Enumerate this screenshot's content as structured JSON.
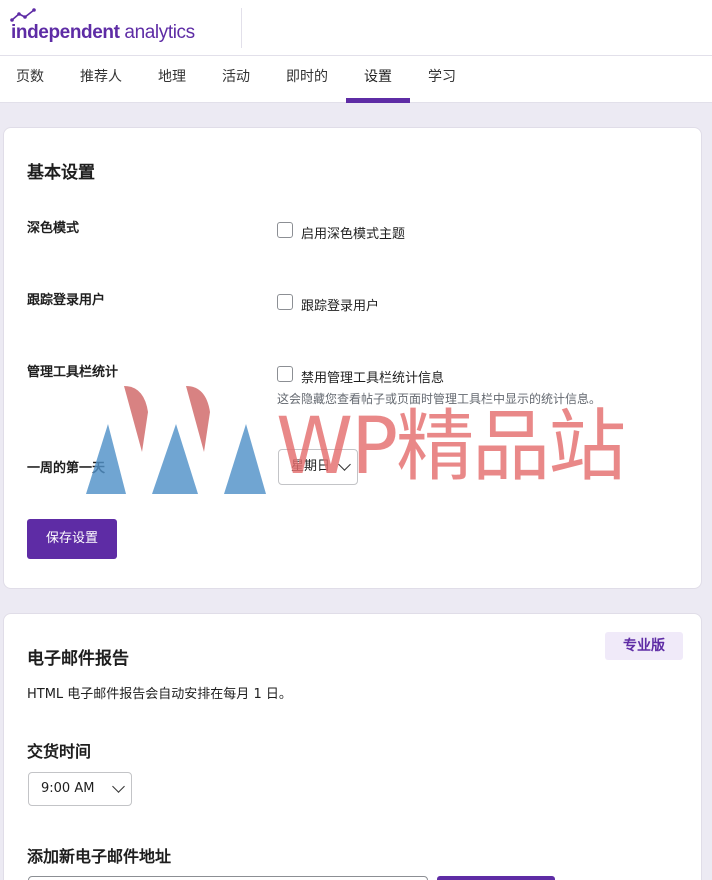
{
  "brand": {
    "name_bold": "independent",
    "name_light": " analytics"
  },
  "tabs": [
    {
      "label": "页数"
    },
    {
      "label": "推荐人"
    },
    {
      "label": "地理"
    },
    {
      "label": "活动"
    },
    {
      "label": "即时的"
    },
    {
      "label": "设置",
      "active": true
    },
    {
      "label": "学习"
    }
  ],
  "basic": {
    "title": "基本设置",
    "dark_mode": {
      "label": "深色模式",
      "checkbox_label": "启用深色模式主题",
      "checked": false
    },
    "track_logged": {
      "label": "跟踪登录用户",
      "checkbox_label": "跟踪登录用户",
      "checked": false
    },
    "toolbar_stats": {
      "label": "管理工具栏统计",
      "checkbox_label": "禁用管理工具栏统计信息",
      "description": "这会隐藏您查看帖子或页面时管理工具栏中显示的统计信息。",
      "checked": false
    },
    "week_start": {
      "label": "一周的第一天",
      "value": "星期日"
    },
    "save_button": "保存设置"
  },
  "email": {
    "title": "电子邮件报告",
    "pro_badge": "专业版",
    "description": "HTML 电子邮件报告会自动安排在每月 1 日。",
    "delivery_time_title": "交货时间",
    "delivery_time_value": "9:00 AM",
    "add_email_title": "添加新电子邮件地址"
  },
  "watermark": {
    "text": "WP精品站"
  },
  "colors": {
    "accent": "#5e2ca5",
    "background": "#eceaf3",
    "badge_bg": "#f0eaf9"
  }
}
